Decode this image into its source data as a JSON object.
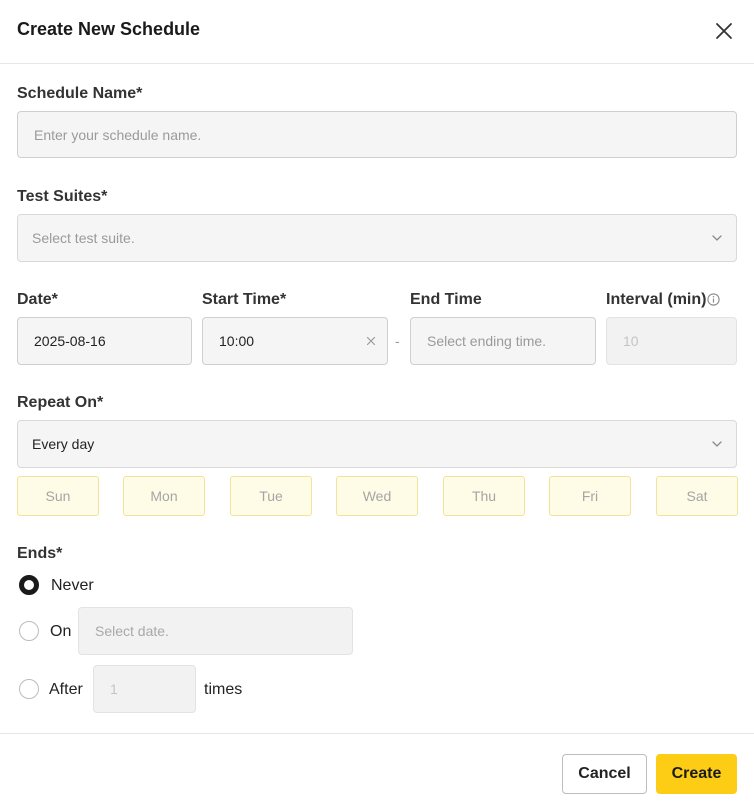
{
  "modal": {
    "title": "Create New Schedule",
    "accent_color": "#fccd14"
  },
  "schedule_name": {
    "label": "Schedule Name*",
    "placeholder": "Enter your schedule name."
  },
  "test_suites": {
    "label": "Test Suites*",
    "placeholder": "Select test suite."
  },
  "date": {
    "label": "Date*",
    "value": "2025-08-16"
  },
  "start_time": {
    "label": "Start Time*",
    "value": "10:00"
  },
  "separator": "-",
  "end_time": {
    "label": "End Time",
    "placeholder": "Select ending time."
  },
  "interval": {
    "label": "Interval (min)",
    "value": "10"
  },
  "repeat_on": {
    "label": "Repeat On*",
    "value": "Every day",
    "days": [
      "Sun",
      "Mon",
      "Tue",
      "Wed",
      "Thu",
      "Fri",
      "Sat"
    ]
  },
  "ends": {
    "label": "Ends*",
    "never_label": "Never",
    "on_label": "On",
    "on_placeholder": "Select date.",
    "after_label": "After",
    "after_value": "1",
    "times_label": "times",
    "selected": "never"
  },
  "footer": {
    "cancel_label": "Cancel",
    "create_label": "Create"
  },
  "icons": {
    "close": "close-icon",
    "chevron": "chevron-down-icon",
    "clear": "clear-icon",
    "info": "info-icon"
  }
}
